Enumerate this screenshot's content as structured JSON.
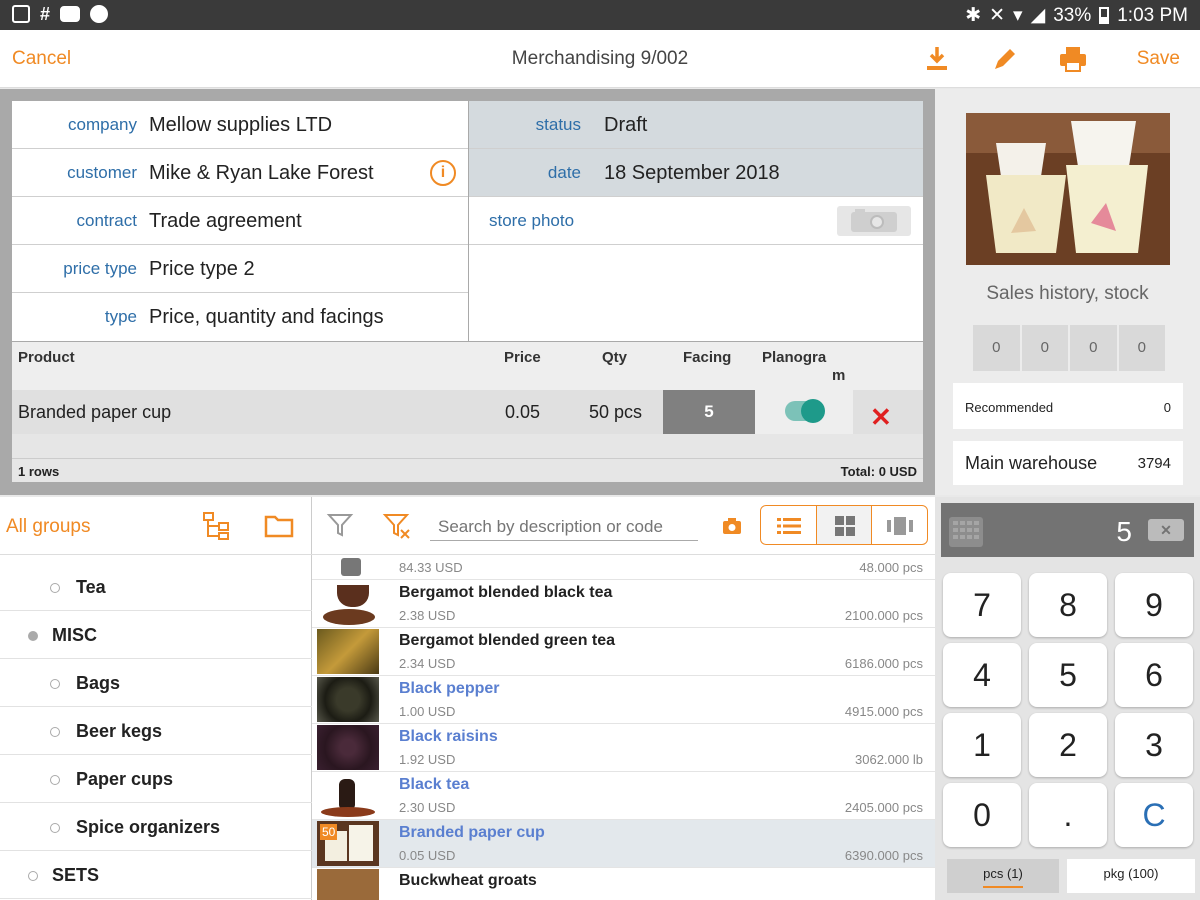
{
  "statusbar": {
    "battery": "33%",
    "time": "1:03 PM"
  },
  "toolbar": {
    "cancel_label": "Cancel",
    "title": "Merchandising 9/002",
    "save_label": "Save"
  },
  "form": {
    "company_label": "company",
    "company_value": "Mellow supplies LTD",
    "customer_label": "customer",
    "customer_value": "Mike & Ryan Lake Forest",
    "contract_label": "contract",
    "contract_value": "Trade agreement",
    "price_type_label": "price type",
    "price_type_value": "Price type 2",
    "type_label": "type",
    "type_value": "Price, quantity and facings",
    "status_label": "status",
    "status_value": "Draft",
    "date_label": "date",
    "date_value": "18 September 2018",
    "store_photo_label": "store photo"
  },
  "products": {
    "headers": {
      "product": "Product",
      "price": "Price",
      "qty": "Qty",
      "facing": "Facing",
      "planogram_1": "Planogra",
      "planogram_2": "m"
    },
    "rows": [
      {
        "product": "Branded paper cup",
        "price": "0.05",
        "qty": "50 pcs",
        "facing": "5",
        "planogram": true
      }
    ],
    "rows_count": "1 rows",
    "total": "Total: 0 USD"
  },
  "side": {
    "sales_title": "Sales history, stock",
    "stock": [
      "0",
      "0",
      "0",
      "0"
    ],
    "recommended_label": "Recommended",
    "recommended_value": "0",
    "warehouse_label": "Main warehouse",
    "warehouse_value": "3794"
  },
  "groups": {
    "header": "All groups",
    "items": [
      {
        "label": "Tea"
      },
      {
        "label": "MISC"
      },
      {
        "label": "Bags"
      },
      {
        "label": "Beer kegs"
      },
      {
        "label": "Paper cups"
      },
      {
        "label": "Spice organizers"
      },
      {
        "label": "SETS"
      }
    ]
  },
  "catalog": {
    "search_placeholder": "Search by description or code",
    "items": [
      {
        "name": "",
        "price": "84.33 USD",
        "qty": "48.000 pcs"
      },
      {
        "name": "Bergamot blended black tea",
        "price": "2.38 USD",
        "qty": "2100.000 pcs"
      },
      {
        "name": "Bergamot blended green tea",
        "price": "2.34 USD",
        "qty": "6186.000 pcs"
      },
      {
        "name": "Black pepper",
        "price": "1.00 USD",
        "qty": "4915.000 pcs"
      },
      {
        "name": "Black raisins",
        "price": "1.92 USD",
        "qty": "3062.000 lb"
      },
      {
        "name": "Black tea",
        "price": "2.30 USD",
        "qty": "2405.000 pcs"
      },
      {
        "name": "Branded paper cup",
        "price": "0.05 USD",
        "qty": "6390.000 pcs",
        "badge": "50"
      },
      {
        "name": "Buckwheat groats",
        "price": "",
        "qty": ""
      }
    ]
  },
  "keypad": {
    "display": "5",
    "keys": [
      "7",
      "8",
      "9",
      "4",
      "5",
      "6",
      "1",
      "2",
      "3",
      "0",
      ".",
      "C"
    ],
    "unit_pcs": "pcs (1)",
    "unit_pkg": "pkg (100)"
  },
  "colors": {
    "accent": "#f08a24",
    "label_blue": "#2e6ea8",
    "link_blue": "#5a7fd0",
    "toggle": "#1e9a8a",
    "delete": "#e02020"
  }
}
